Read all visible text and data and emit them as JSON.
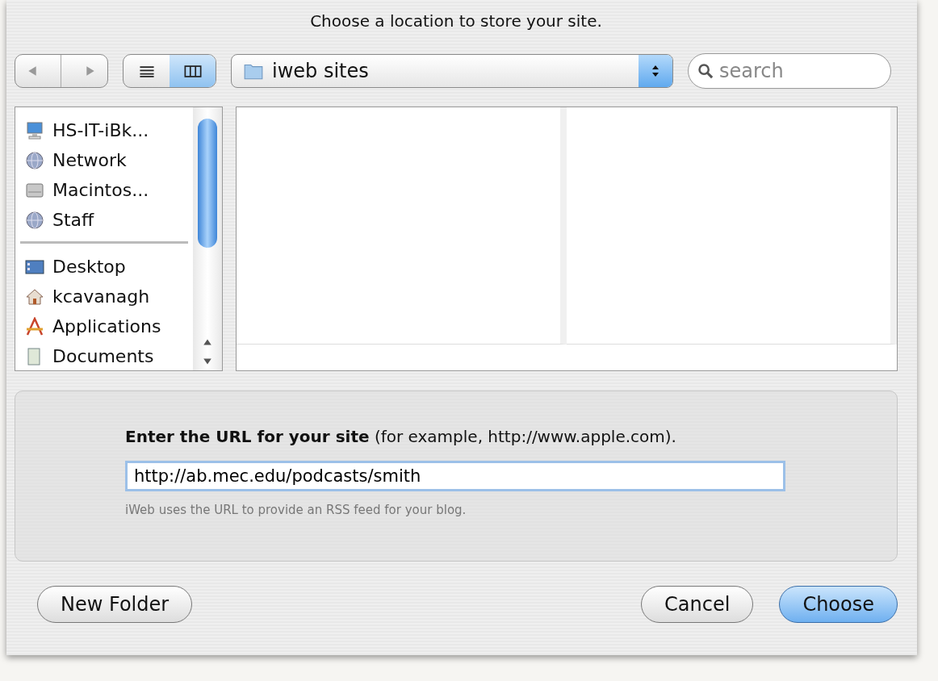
{
  "dialog": {
    "title": "Choose a location to store your site."
  },
  "toolbar": {
    "view_modes": [
      {
        "kind": "list",
        "selected": false
      },
      {
        "kind": "columns",
        "selected": true
      }
    ],
    "location": "iweb sites",
    "search": {
      "placeholder": "search"
    }
  },
  "sidebar": {
    "items": [
      {
        "kind": "computer",
        "label": "HS-IT-iBk..."
      },
      {
        "kind": "network",
        "label": "Network"
      },
      {
        "kind": "disk",
        "label": "Macintos..."
      },
      {
        "kind": "network",
        "label": "Staff"
      },
      {
        "kind": "divider"
      },
      {
        "kind": "desktop",
        "label": "Desktop"
      },
      {
        "kind": "home",
        "label": "kcavanagh"
      },
      {
        "kind": "apps",
        "label": "Applications"
      },
      {
        "kind": "docs",
        "label": "Documents"
      }
    ]
  },
  "url_panel": {
    "prompt": "**Enter the URL for your site** (for example, http://www.apple.com).",
    "value": "http://ab.mec.edu/podcasts/smith",
    "hint": "iWeb uses the URL to provide an RSS feed for your blog."
  },
  "buttons": [
    {
      "kind": "plain",
      "label": "New Folder"
    },
    {
      "kind": "plain",
      "label": "Cancel"
    },
    {
      "kind": "default",
      "label": "Choose"
    }
  ]
}
